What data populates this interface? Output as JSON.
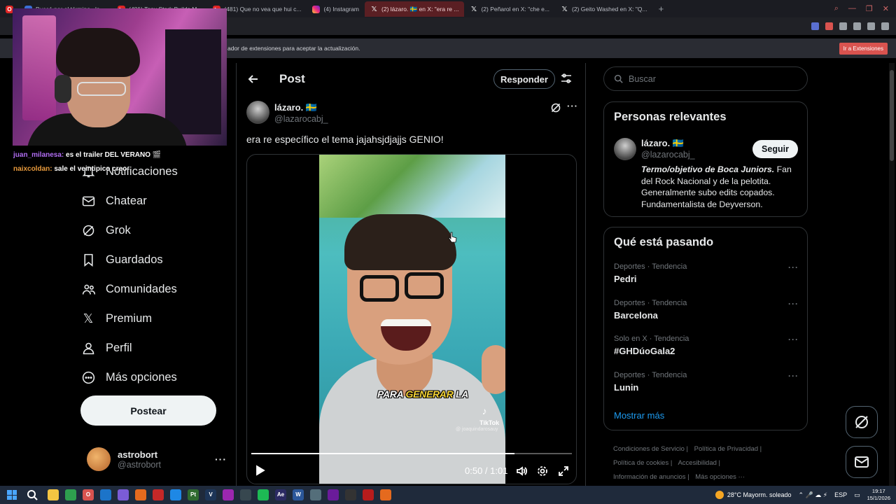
{
  "browser": {
    "tabs": [
      {
        "label": "Buscó por el término «la ...",
        "icon": "tab-favicon",
        "active": false
      },
      {
        "label": "(481) Tony Stark Builds M...",
        "icon": "youtube-icon",
        "active": false
      },
      {
        "label": "(481) Que no vea que hui c...",
        "icon": "youtube-icon",
        "active": false
      },
      {
        "label": "(4) Instagram",
        "icon": "instagram-icon",
        "active": false
      },
      {
        "label": "(2) lázaro. 🇸🇪 en X: \"era re ...",
        "icon": "x-icon",
        "active": true
      },
      {
        "label": "(2) Peñarol en X: \"che e...",
        "icon": "x-icon",
        "active": false
      },
      {
        "label": "(2) Geito Washed en X: \"Q...",
        "icon": "x-icon",
        "active": false
      }
    ],
    "new_tab": "+",
    "notice_text": "ador de extensiones para aceptar la actualización.",
    "notice_button": "Ir a Extensiones"
  },
  "stream": {
    "chat": [
      {
        "user": "juan_milanesa:",
        "message": "es el trailer DEL VERANO 🎬",
        "user_color": "#b16df2"
      },
      {
        "user": "naixcoldan:",
        "message": "sale el veintipico creo",
        "user_color": "#e89a3c"
      }
    ]
  },
  "nav": {
    "items": [
      {
        "label": "Notificaciones",
        "icon": "bell-icon"
      },
      {
        "label": "Chatear",
        "icon": "mail-icon"
      },
      {
        "label": "Grok",
        "icon": "grok-icon"
      },
      {
        "label": "Guardados",
        "icon": "bookmark-icon"
      },
      {
        "label": "Comunidades",
        "icon": "communities-icon"
      },
      {
        "label": "Premium",
        "icon": "x-logo-icon"
      },
      {
        "label": "Perfil",
        "icon": "profile-icon"
      },
      {
        "label": "Más opciones",
        "icon": "more-circle-icon"
      }
    ],
    "post_button": "Postear",
    "account": {
      "name": "astrobort",
      "handle": "@astrobort",
      "more": "···"
    }
  },
  "main": {
    "title": "Post",
    "reply_button": "Responder",
    "author": {
      "name": "lázaro. 🇸🇪",
      "handle": "@lazarocabj_",
      "more": "···"
    },
    "text": "era re específico el tema jajahsjdjajjs GENIO!",
    "video": {
      "caption_pre": "PARA ",
      "caption_highlight": "GENERAR",
      "caption_post": " LA",
      "watermark": "TikTok",
      "watermark_handle": "@ joaquindarosauy",
      "current_time": "0:50",
      "separator": " / ",
      "duration": "1:01",
      "progress_fraction": 0.82
    }
  },
  "sidebar": {
    "search_placeholder": "Buscar",
    "relevant": {
      "title": "Personas relevantes",
      "name": "lázaro. 🇸🇪",
      "handle": "@lazarocabj_",
      "follow": "Seguir",
      "bio_italic": "Termo/objetivo de Boca Juniors.",
      "bio_rest": " Fan del Rock Nacional y de la pelotita. Generalmente subo edits copados. Fundamentalista de Deyverson."
    },
    "trends": {
      "title": "Qué está pasando",
      "items": [
        {
          "meta": "Deportes · Tendencia",
          "name": "Pedri"
        },
        {
          "meta": "Deportes · Tendencia",
          "name": "Barcelona"
        },
        {
          "meta": "Solo en X · Tendencia",
          "name": "#GHDúoGala2"
        },
        {
          "meta": "Deportes · Tendencia",
          "name": "Lunin"
        }
      ],
      "more_dots": "···",
      "show_more": "Mostrar más"
    },
    "footer": [
      "Condiciones de Servicio |",
      "Política de Privacidad |",
      "Política de cookies |",
      "Accesibilidad |",
      "Información de anuncios |",
      "Más opciones ···"
    ]
  },
  "taskbar": {
    "weather": "28°C  Mayorm. soleado",
    "lang": "ESP",
    "time": "19:17",
    "date": "15/1/2026"
  },
  "colors": {
    "accent": "#1d9bf0",
    "background": "#000000",
    "border": "#2f3336",
    "muted": "#71767b",
    "caption_highlight": "#f5d437"
  }
}
